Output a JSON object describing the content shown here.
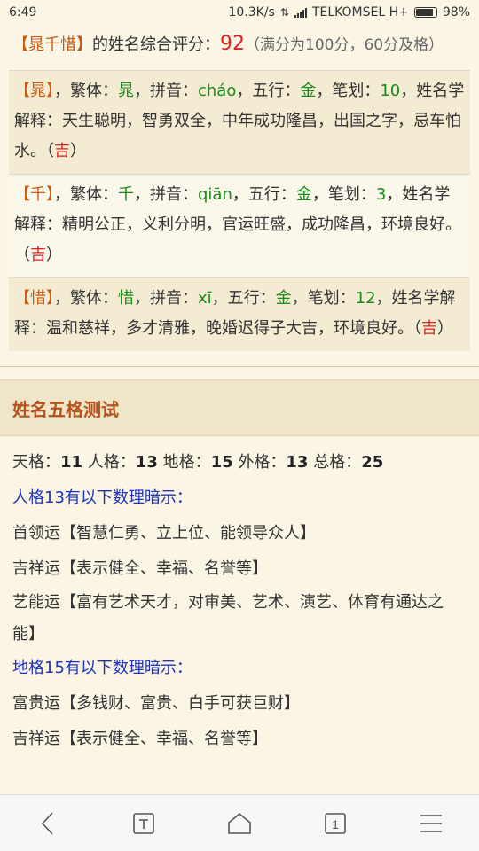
{
  "status": {
    "time": "6:49",
    "speed": "10.3K/s",
    "carrier": "TELKOMSEL H+",
    "battery": "98%",
    "battery_level": 0.98
  },
  "summary": {
    "bracket_open": "【",
    "name": "晁千惜",
    "bracket_close": "】",
    "text": "的姓名综合评分：",
    "score": "92",
    "note": "（满分为100分，60分及格）"
  },
  "chars": [
    {
      "char": "晁",
      "pre": "，繁体：",
      "trad": "晁",
      "pinyin_label": "，拼音：",
      "pinyin": "cháo",
      "wuxing_label": "，五行：",
      "wuxing": "金",
      "strokes_label": "，笔划：",
      "strokes": "10",
      "explain": "，姓名学解释：天生聪明，智勇双全，中年成功隆昌，出国之字，忌车怕水。（",
      "luck": "吉",
      "end": "）"
    },
    {
      "char": "千",
      "pre": "，繁体：",
      "trad": "千",
      "pinyin_label": "，拼音：",
      "pinyin": "qiān",
      "wuxing_label": "，五行：",
      "wuxing": "金",
      "strokes_label": "，笔划：",
      "strokes": "3",
      "explain": "，姓名学解释：精明公正，义利分明，官运旺盛，成功隆昌，环境良好。（",
      "luck": "吉",
      "end": "）"
    },
    {
      "char": "惜",
      "pre": "，繁体：",
      "trad": "惜",
      "pinyin_label": "，拼音：",
      "pinyin": "xī",
      "wuxing_label": "，五行：",
      "wuxing": "金",
      "strokes_label": "，笔划：",
      "strokes": "12",
      "explain": "，姓名学解释：温和慈祥，多才清雅，晚婚迟得子大吉，环境良好。（",
      "luck": "吉",
      "end": "）"
    }
  ],
  "section": {
    "title": "姓名五格测试"
  },
  "five_grid": {
    "tian_label": "天格：",
    "tian": "11",
    "ren_label": "人格：",
    "ren": "13",
    "di_label": "地格：",
    "di": "15",
    "wai_label": "外格：",
    "wai": "13",
    "zong_label": "总格：",
    "zong": "25"
  },
  "ren_hint": "人格13有以下数理暗示：",
  "ren_lucks": [
    {
      "label": "首领运",
      "text": "【智慧仁勇、立上位、能领导众人】"
    },
    {
      "label": "吉祥运",
      "text": "【表示健全、幸福、名誉等】"
    },
    {
      "label": "艺能运",
      "text": "【富有艺术天才，对审美、艺术、演艺、体育有通达之能】"
    }
  ],
  "di_hint": "地格15有以下数理暗示：",
  "di_lucks": [
    {
      "label": "富贵运",
      "text": "【多钱财、富贵、白手可获巨财】"
    },
    {
      "label": "吉祥运",
      "text": "【表示健全、幸福、名誉等】"
    }
  ],
  "navbar": {
    "tabs_count": "1"
  }
}
